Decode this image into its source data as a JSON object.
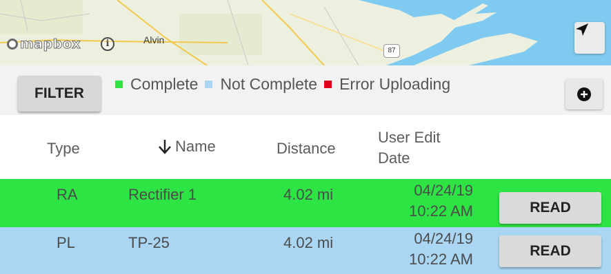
{
  "map": {
    "logo_text": "mapbox",
    "city_label": "Alvin",
    "highway_label": "87",
    "info_icon": "info-icon",
    "locate_icon": "navigation-arrow-icon"
  },
  "filter_bar": {
    "filter_label": "FILTER",
    "legend": [
      {
        "label": "Complete",
        "color": "#2ee344"
      },
      {
        "label": "Not Complete",
        "color": "#aad6f3"
      },
      {
        "label": "Error Uploading",
        "color": "#e0001b"
      }
    ],
    "add_icon": "plus-circle-icon"
  },
  "table": {
    "columns": {
      "type": "Type",
      "name": "Name",
      "distance": "Distance",
      "date_line1": "User Edit",
      "date_line2": "Date"
    },
    "sort_icon": "arrow-down-icon",
    "rows": [
      {
        "type": "RA",
        "name": "Rectifier 1",
        "distance": "4.02 mi",
        "date": "04/24/19",
        "time": "10:22 AM",
        "action": "READ",
        "status_color": "#2ee344"
      },
      {
        "type": "PL",
        "name": "TP-25",
        "distance": "4.02 mi",
        "date": "04/24/19",
        "time": "10:22 AM",
        "action": "READ",
        "status_color": "#aad6f3"
      }
    ]
  }
}
